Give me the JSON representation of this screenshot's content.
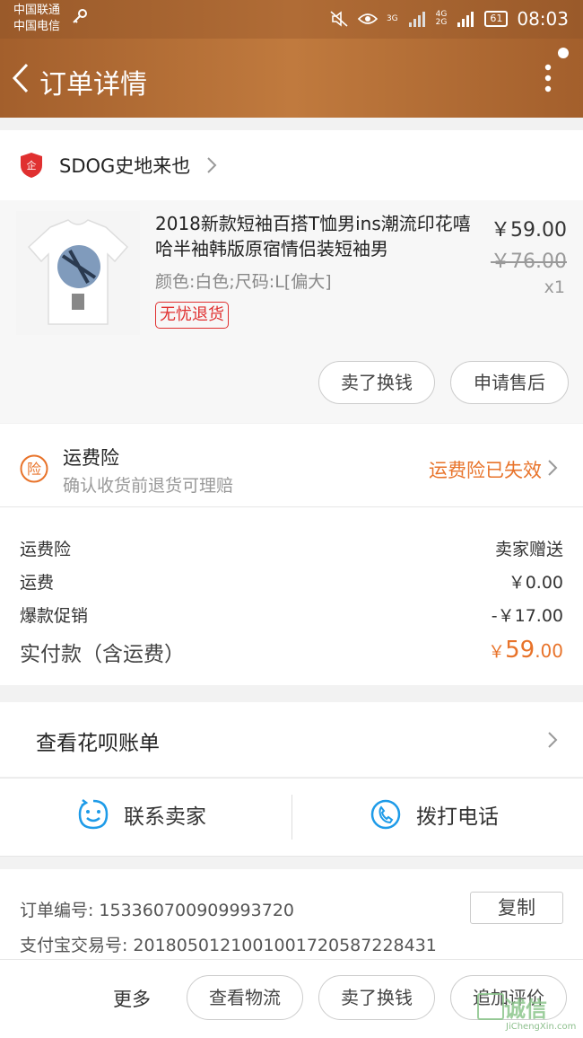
{
  "status_bar": {
    "carrier1": "中国联通",
    "carrier2": "中国电信",
    "battery": "61",
    "time": "08:03",
    "net_top": "4G",
    "net_bottom": "2G",
    "net_3g": "3G"
  },
  "header": {
    "title": "订单详情"
  },
  "store": {
    "name": "SDOG史地来也",
    "logo_text": "企"
  },
  "product": {
    "title": "2018新款短袖百搭T恤男ins潮流印花嘻哈半袖韩版原宿情侣装短袖男",
    "price": "￥59.00",
    "original_price": "￥76.00",
    "quantity": "x1",
    "spec": "颜色:白色;尺码:L[偏大]",
    "tag": "无忧退货",
    "btn_sell": "卖了换钱",
    "btn_after_sale": "申请售后"
  },
  "insurance": {
    "icon_text": "险",
    "title": "运费险",
    "subtitle": "确认收货前退货可理赔",
    "status": "运费险已失效"
  },
  "costs": {
    "rows": [
      {
        "label": "运费险",
        "value": "卖家赠送"
      },
      {
        "label": "运费",
        "value": "￥0.00"
      },
      {
        "label": "爆款促销",
        "value": "-￥17.00"
      }
    ],
    "total_label": "实付款（含运费）",
    "total_currency": "￥",
    "total_int": "59",
    "total_dec": ".00"
  },
  "huabei": {
    "label": "查看花呗账单"
  },
  "contact": {
    "seller": "联系卖家",
    "call": "拨打电话"
  },
  "order_info": {
    "order_no_label": "订单编号:",
    "order_no": "153360700909993720",
    "alipay_label": "支付宝交易号:",
    "alipay_no": "2018050121001001720587228431",
    "copy": "复制"
  },
  "bottom_bar": {
    "more": "更多",
    "logistics": "查看物流",
    "sell": "卖了换钱",
    "review": "追加评价"
  },
  "watermark": {
    "text": "诚信",
    "sub": "JiChengXin.com"
  },
  "colors": {
    "header": "#b06c36",
    "accent": "#e8732a",
    "tag_red": "#e03030",
    "icon_blue": "#1e9be8"
  }
}
